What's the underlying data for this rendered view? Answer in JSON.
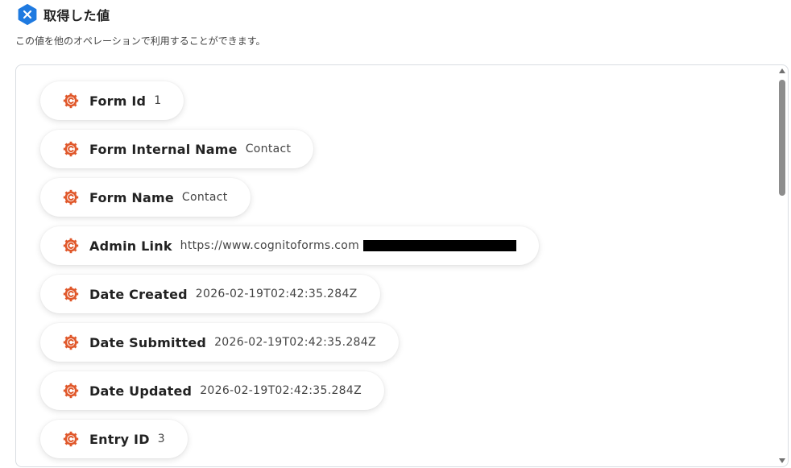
{
  "header": {
    "title": "取得した値",
    "description": "この値を他のオペレーションで利用することができます。",
    "icon": "x-badge-icon",
    "accent": "#1f7ae0"
  },
  "fields": [
    {
      "label": "Form Id",
      "value": "1"
    },
    {
      "label": "Form Internal Name",
      "value": "Contact"
    },
    {
      "label": "Form Name",
      "value": "Contact"
    },
    {
      "label": "Admin Link",
      "value": "https://www.cognitoforms.com",
      "redacted": true
    },
    {
      "label": "Date Created",
      "value": "2026-02-19T02:42:35.284Z"
    },
    {
      "label": "Date Submitted",
      "value": "2026-02-19T02:42:35.284Z"
    },
    {
      "label": "Date Updated",
      "value": "2026-02-19T02:42:35.284Z"
    },
    {
      "label": "Entry ID",
      "value": "3"
    }
  ],
  "colors": {
    "cognito_icon": "#e0582b",
    "panel_border": "#d9dde2"
  }
}
